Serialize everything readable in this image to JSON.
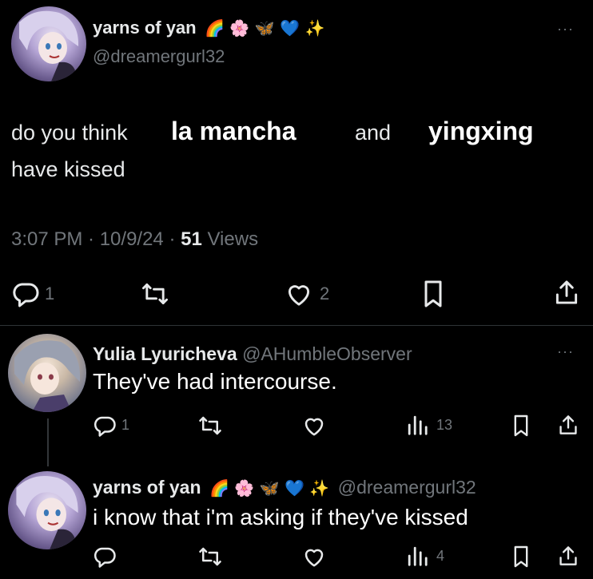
{
  "main_post": {
    "display_name": "yarns of yan",
    "name_emojis": [
      "🌈",
      "🌸",
      "🦋",
      "💙",
      "✨"
    ],
    "handle": "@dreamergurl32",
    "text": {
      "prefix": "do you think",
      "name1": "la mancha",
      "middle": "and",
      "name2": "yingxing",
      "line2": "have kissed"
    },
    "timestamp": "3:07 PM · 10/9/24 · ",
    "views_count": "51",
    "views_label": " Views",
    "actions": {
      "replies": "1",
      "reposts": "",
      "likes": "2"
    }
  },
  "reply1": {
    "display_name": "Yulia Lyuricheva",
    "handle": "@AHumbleObserver",
    "text": "They've had intercourse.",
    "actions": {
      "replies": "1",
      "views": "13"
    }
  },
  "reply2": {
    "display_name": "yarns of yan",
    "name_emojis": [
      "🌈",
      "🌸",
      "🦋",
      "💙",
      "✨"
    ],
    "handle": "@dreamergurl32",
    "text": "i know that i'm asking if they've kissed",
    "actions": {
      "views": "4"
    }
  },
  "more_label": "···"
}
